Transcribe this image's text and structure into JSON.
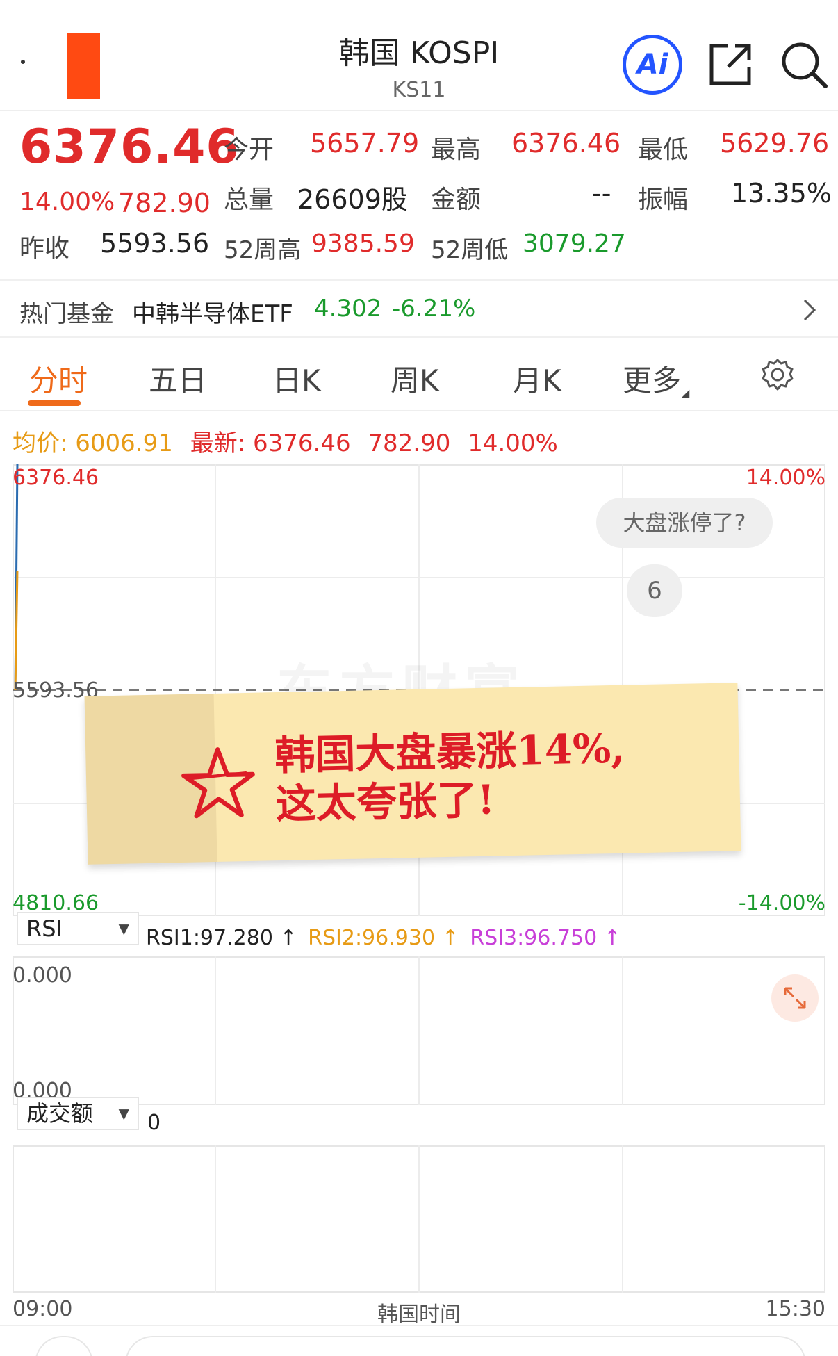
{
  "header": {
    "title": "韩国 KOSPI",
    "code": "KS11",
    "ai_label": "Ai"
  },
  "quote": {
    "price": "6376.46",
    "change_pct": "14.00%",
    "change_amt": "782.90",
    "open_label": "今开",
    "open": "5657.79",
    "high_label": "最高",
    "high": "6376.46",
    "low_label": "最低",
    "low": "5629.76",
    "volume_label": "总量",
    "volume": "26609股",
    "amount_label": "金额",
    "amount": "--",
    "amplitude_label": "振幅",
    "amplitude": "13.35%",
    "prev_close_label": "昨收",
    "prev_close": "5593.56",
    "w52_high_label": "52周高",
    "w52_high": "9385.59",
    "w52_low_label": "52周低",
    "w52_low": "3079.27"
  },
  "hot_fund": {
    "label": "热门基金",
    "name": "中韩半导体ETF",
    "price": "4.302",
    "change": "-6.21%"
  },
  "tabs": [
    "分时",
    "五日",
    "日K",
    "周K",
    "月K",
    "更多"
  ],
  "active_tab": 0,
  "info_line": {
    "avg_label": "均价:",
    "avg": "6006.91",
    "latest_label": "最新:",
    "latest": "6376.46",
    "change_amt": "782.90",
    "change_pct": "14.00%"
  },
  "chart": {
    "y_top": "6376.46",
    "y_mid": "5593.56",
    "y_bottom": "4810.66",
    "pct_top": "14.00%",
    "pct_bottom": "-14.00%",
    "bubble_text": "大盘涨停了?",
    "bubble_count": "6",
    "watermark": "东方财富",
    "x_start": "09:00",
    "x_mid": "韩国时间",
    "x_end": "15:30"
  },
  "chart_data": {
    "type": "line",
    "title": "",
    "series": [
      {
        "name": "",
        "color": "#2b6cb0",
        "x": [
          "09:00",
          "09:01"
        ],
        "values": [
          5593.56,
          6376.46
        ]
      },
      {
        "name": "",
        "color": "#e79b16",
        "x": [
          "09:00",
          "09:01"
        ],
        "values": [
          5593.56,
          6006.91
        ]
      }
    ],
    "reference_line": 5593.56,
    "ylim": [
      4810.66,
      6376.46
    ],
    "grid": true,
    "x_range": [
      "09:00",
      "15:30"
    ]
  },
  "sticker": {
    "line1": "韩国大盘暴涨14%,",
    "line2": "这太夸张了!"
  },
  "rsi": {
    "selector": "RSI",
    "rsi1": "RSI1:97.280 ↑",
    "rsi2": "RSI2:96.930 ↑",
    "rsi3": "RSI3:96.750 ↑",
    "rsi1_color": "#222222",
    "rsi2_color": "#e79b16",
    "rsi3_color": "#c83fd8",
    "y_top": "0.000",
    "y_bottom": "0.000"
  },
  "volume": {
    "selector": "成交额",
    "value": "0"
  },
  "colors": {
    "up": "#e02b2b",
    "down": "#1a9a2c",
    "accent": "#ef6a1a",
    "ai": "#2354ff"
  }
}
